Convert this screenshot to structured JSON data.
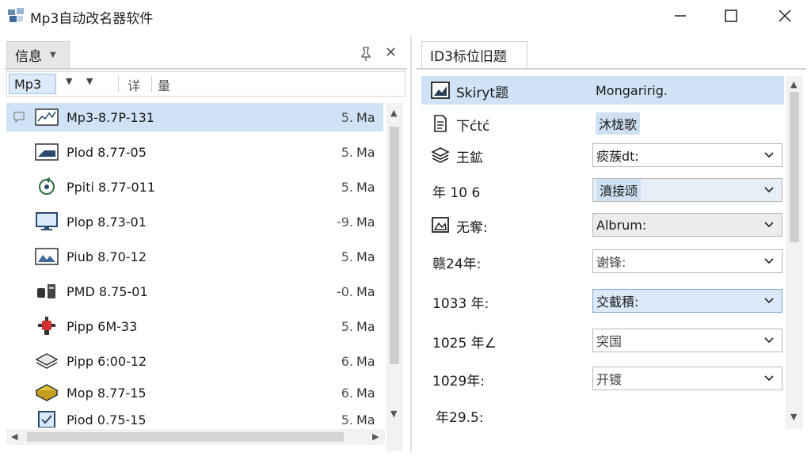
{
  "window": {
    "title": "Mp3自动改名器软件"
  },
  "left_panel": {
    "tab_label": "信息",
    "toolbar": {
      "filter_value": "Mp3",
      "field1": "详",
      "field2": "量"
    },
    "files": [
      {
        "name": "Mp3-8.7P-131",
        "size": "5.",
        "mod": "Ma"
      },
      {
        "name": "Plod 8.77-05",
        "size": "5.",
        "mod": "Ma"
      },
      {
        "name": "Ppiti 8.77-011",
        "size": "5.",
        "mod": "Ma"
      },
      {
        "name": "Plop 8.73-01",
        "size": "-9.",
        "mod": "Ma"
      },
      {
        "name": "Piub 8.70-12",
        "size": "5.",
        "mod": "Ma"
      },
      {
        "name": "PMD 8.75-01",
        "size": "-0.",
        "mod": "Ma"
      },
      {
        "name": "Pipp 6M-33",
        "size": "5.",
        "mod": "Ma"
      },
      {
        "name": "Pipp 6:00-12",
        "size": "6.",
        "mod": "Ma"
      },
      {
        "name": "Mop 8.77-15",
        "size": "6.",
        "mod": "Ma"
      },
      {
        "name": "Piod 0.75-15",
        "size": "5.",
        "mod": "Ma"
      }
    ]
  },
  "right_panel": {
    "tab_label": "ID3标位旧题",
    "properties": [
      {
        "label": "Skiryt题",
        "value": "Mongaririg."
      },
      {
        "label": "下ćtć",
        "value": "沐栊歌"
      },
      {
        "label": "王鉱",
        "value": "痰蔟dt:"
      },
      {
        "label": "年 10 6",
        "value": "濆接颂"
      },
      {
        "label": "无奪:",
        "value": "Albrum:"
      },
      {
        "label": "赣24年:",
        "value": "谢锋:"
      },
      {
        "label": "1033 年:",
        "value": "交截積:"
      },
      {
        "label": "1025 年∠",
        "value": "突国"
      },
      {
        "label": "1029年:",
        "value": "开镀"
      },
      {
        "label": "年29.5:",
        "value": ""
      }
    ]
  }
}
